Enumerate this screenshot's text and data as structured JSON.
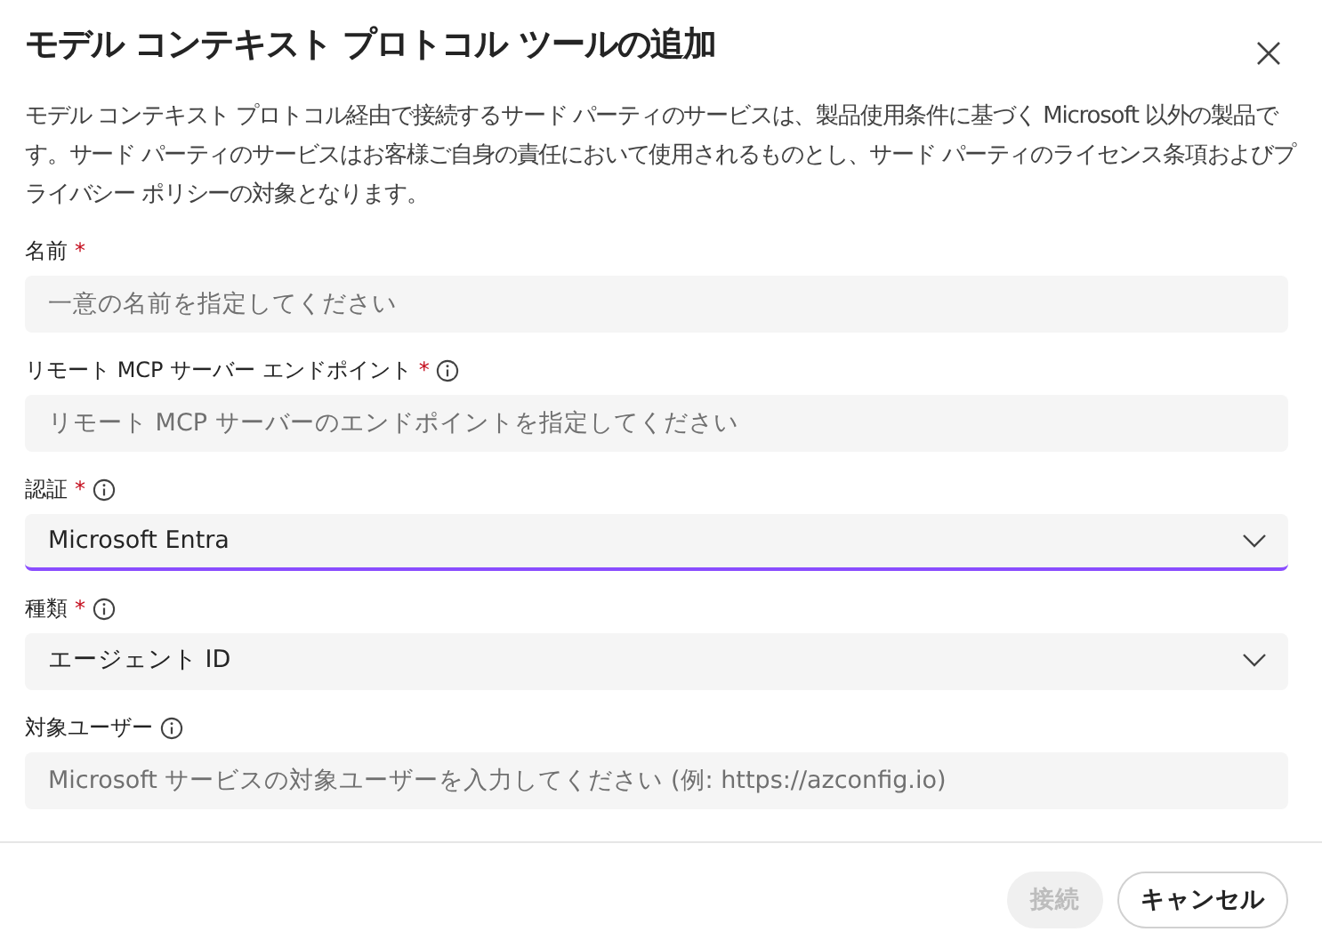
{
  "dialog": {
    "title": "モデル コンテキスト プロトコル ツールの追加",
    "description": "モデル コンテキスト プロトコル経由で接続するサード パーティのサービスは、製品使用条件に基づく Microsoft 以外の製品です。サード パーティのサービスはお客様ご自身の責任において使用されるものとし、サード パーティのライセンス条項およびプライバシー ポリシーの対象となります。",
    "fields": [
      {
        "kind": "text",
        "label": "名前",
        "required": "*",
        "info": false,
        "placeholder": "一意の名前を指定してください",
        "focused": false
      },
      {
        "kind": "text",
        "label": "リモート MCP サーバー エンドポイント",
        "required": "*",
        "info": true,
        "placeholder": "リモート MCP サーバーのエンドポイントを指定してください",
        "focused": false
      },
      {
        "kind": "select",
        "label": "認証",
        "required": "*",
        "info": true,
        "value": "Microsoft Entra",
        "focused": true
      },
      {
        "kind": "select",
        "label": "種類",
        "required": "*",
        "info": true,
        "value": "エージェント ID",
        "focused": false
      },
      {
        "kind": "text",
        "label": "対象ユーザー",
        "info": true,
        "placeholder": "Microsoft サービスの対象ユーザーを入力してください (例: https://azconfig.io)",
        "focused": false
      }
    ],
    "buttons": [
      {
        "label": "接続",
        "disabled": true
      },
      {
        "label": "キャンセル",
        "disabled": false
      }
    ]
  }
}
